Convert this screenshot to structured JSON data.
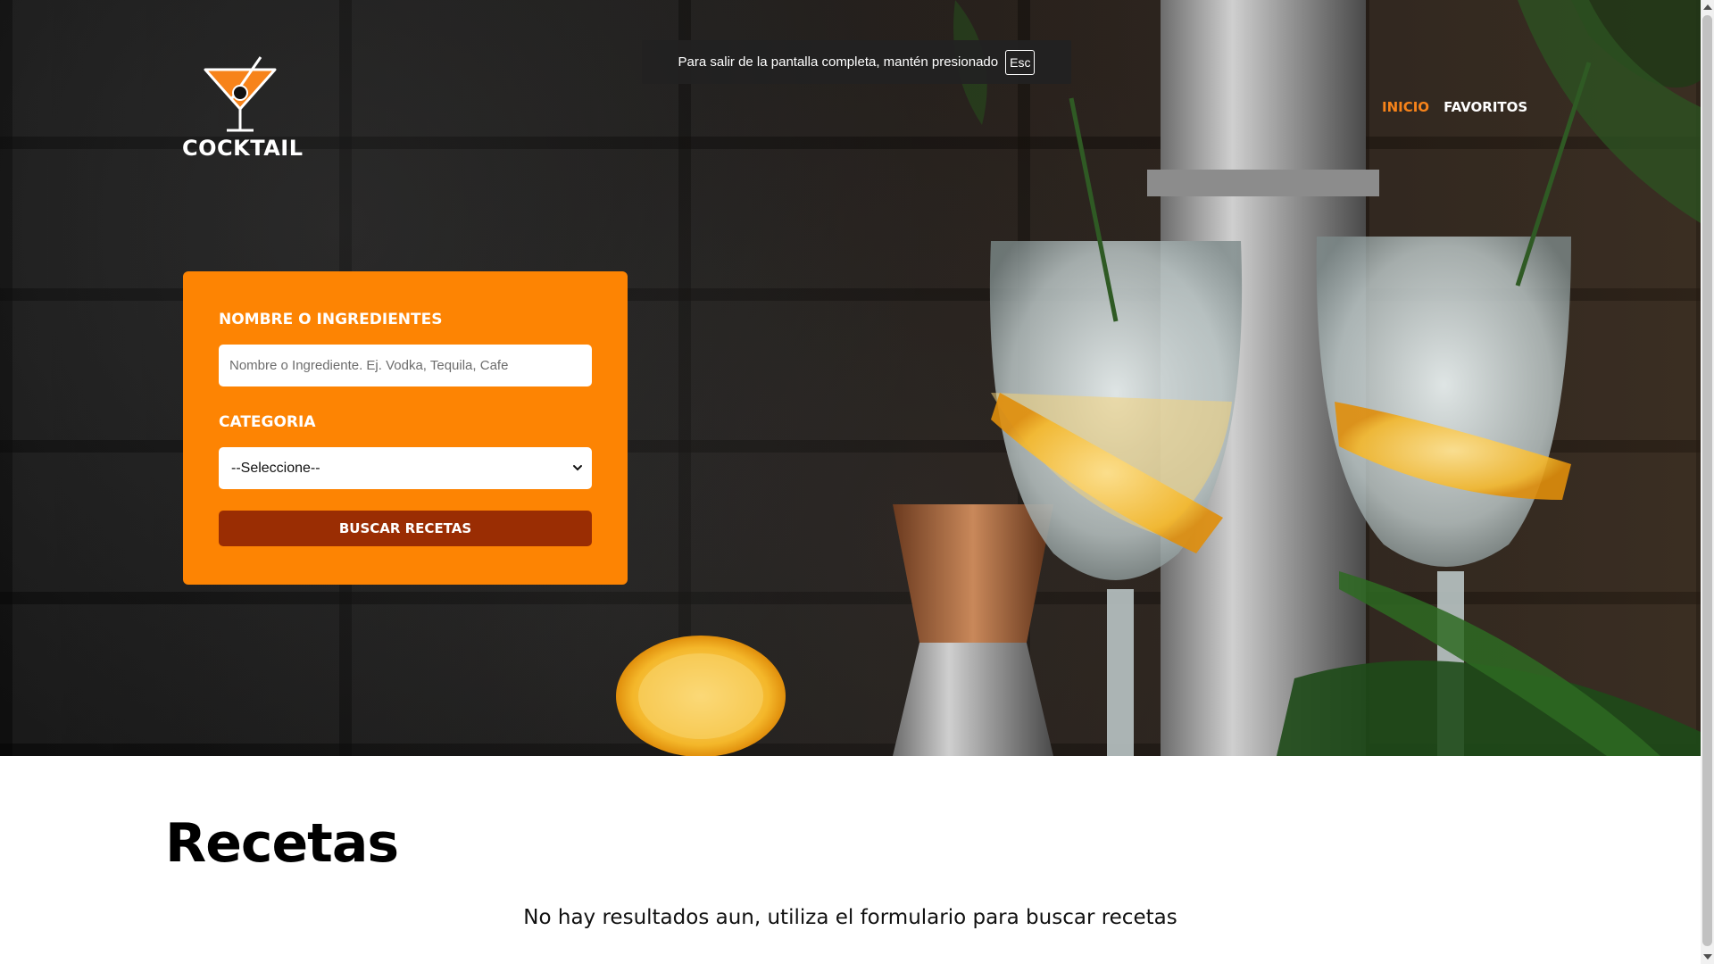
{
  "header": {
    "logo_text": "COCKTAIL",
    "nav": [
      {
        "label": "Inicio",
        "active": true
      },
      {
        "label": "Favoritos",
        "active": false
      }
    ],
    "accent_color": "#f7831a"
  },
  "fullscreen_notice": {
    "text": "Para salir de la pantalla completa, mantén presionado",
    "key": "Esc"
  },
  "search_form": {
    "background_color": "#fd8403",
    "name_label": "Nombre o Ingredientes",
    "name_placeholder": "Nombre o Ingrediente. Ej. Vodka, Tequila, Cafe",
    "name_value": "",
    "category_label": "Categoria",
    "category_selected": "--Seleccione--",
    "submit_label": "Buscar Recetas",
    "submit_color": "#9a2d03"
  },
  "results": {
    "title": "Recetas",
    "empty_message": "No hay resultados aun, utiliza el formulario para buscar recetas"
  },
  "icons": {
    "logo": "cocktail-glass-icon",
    "select_arrow": "chevron-down-icon"
  }
}
